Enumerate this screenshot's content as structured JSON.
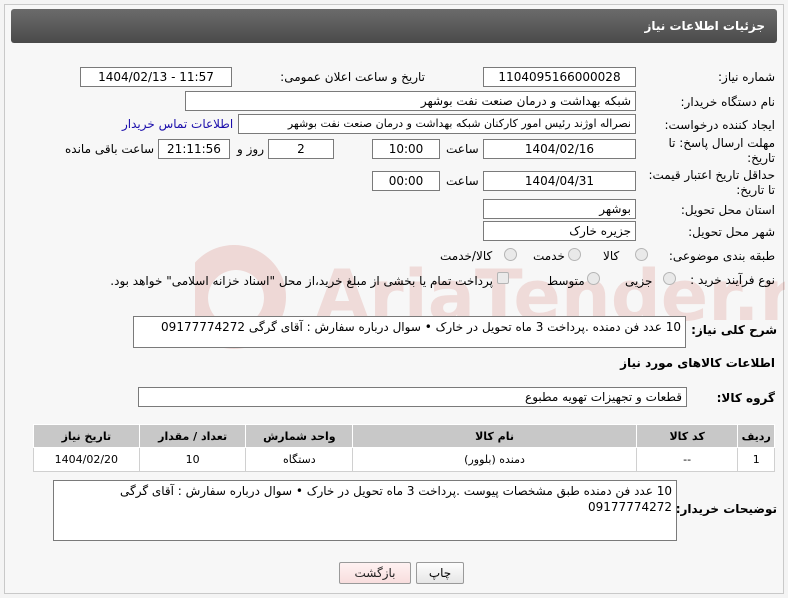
{
  "header": {
    "title": "جزئیات اطلاعات نیاز"
  },
  "form": {
    "need_number": {
      "label": "شماره نیاز:",
      "value": "1104095166000028"
    },
    "announce_datetime": {
      "label": "تاریخ و ساعت اعلان عمومی:",
      "value": "1404/02/13 - 11:57"
    },
    "buyer_org": {
      "label": "نام دستگاه خریدار:",
      "value": "شبکه بهداشت و درمان صنعت نفت بوشهر"
    },
    "creator": {
      "label": "ایجاد کننده درخواست:",
      "value": "نصراله اوژند رئیس امور کارکنان شبکه بهداشت و درمان صنعت نفت بوشهر",
      "contact_link": "اطلاعات تماس خریدار"
    },
    "reply_deadline": {
      "label_line1": "مهلت ارسال پاسخ: تا",
      "label_line2": "تاریخ:",
      "date": "1404/02/16",
      "time_label": "ساعت",
      "time": "10:00",
      "days": "2",
      "days_label": "روز و",
      "remaining": "21:11:56",
      "remaining_label": "ساعت باقی مانده"
    },
    "price_validity": {
      "label_line1": "حداقل تاریخ اعتبار قیمت:",
      "label_line2": "تا تاریخ:",
      "date": "1404/04/31",
      "time_label": "ساعت",
      "time": "00:00"
    },
    "province": {
      "label": "استان محل تحویل:",
      "value": "بوشهر"
    },
    "city": {
      "label": "شهر محل تحویل:",
      "value": "جزیره خارک"
    },
    "category": {
      "label": "طبقه بندی موضوعی:",
      "options": [
        "کالا",
        "خدمت",
        "کالا/خدمت"
      ]
    },
    "process_type": {
      "label": "نوع فرآیند خرید :",
      "options": [
        "جزیی",
        "متوسط"
      ],
      "payment_note": "پرداخت تمام یا بخشی از مبلغ خرید،از محل \"اسناد خزانه اسلامی\" خواهد بود."
    },
    "general_desc": {
      "label": "شرح کلی نیاز:",
      "value": "10 عدد فن دمنده .پرداخت 3 ماه تحویل در خارک •      سوال درباره سفارش : آقای گرگی  09177774272"
    }
  },
  "goods_section": {
    "title": "اطلاعات کالاهای مورد نیاز",
    "group_label": "گروه کالا:",
    "group_value": "قطعات و تجهیزات تهویه مطبوع",
    "table": {
      "headers": [
        "ردیف",
        "کد کالا",
        "نام کالا",
        "واحد شمارش",
        "تعداد / مقدار",
        "تاریخ نیاز"
      ],
      "rows": [
        [
          "1",
          "--",
          "دمنده (بلوور)",
          "دستگاه",
          "10",
          "1404/02/20"
        ]
      ]
    }
  },
  "buyer_notes": {
    "label": "توضیحات خریدار:",
    "value_line1": "10 عدد فن دمنده طبق مشخصات پیوست  .پرداخت 3 ماه تحویل در خارک •      سوال درباره سفارش : آقای گرگی",
    "value_line2": "09177774272"
  },
  "buttons": {
    "print": "چاپ",
    "back": "بازگشت"
  },
  "watermark": {
    "text": "AriaTender.net"
  },
  "colors": {
    "title_bar": "#555555",
    "table_header": "#c8c8c8",
    "link": "#1a0dab",
    "back_button": "#f8dede"
  }
}
